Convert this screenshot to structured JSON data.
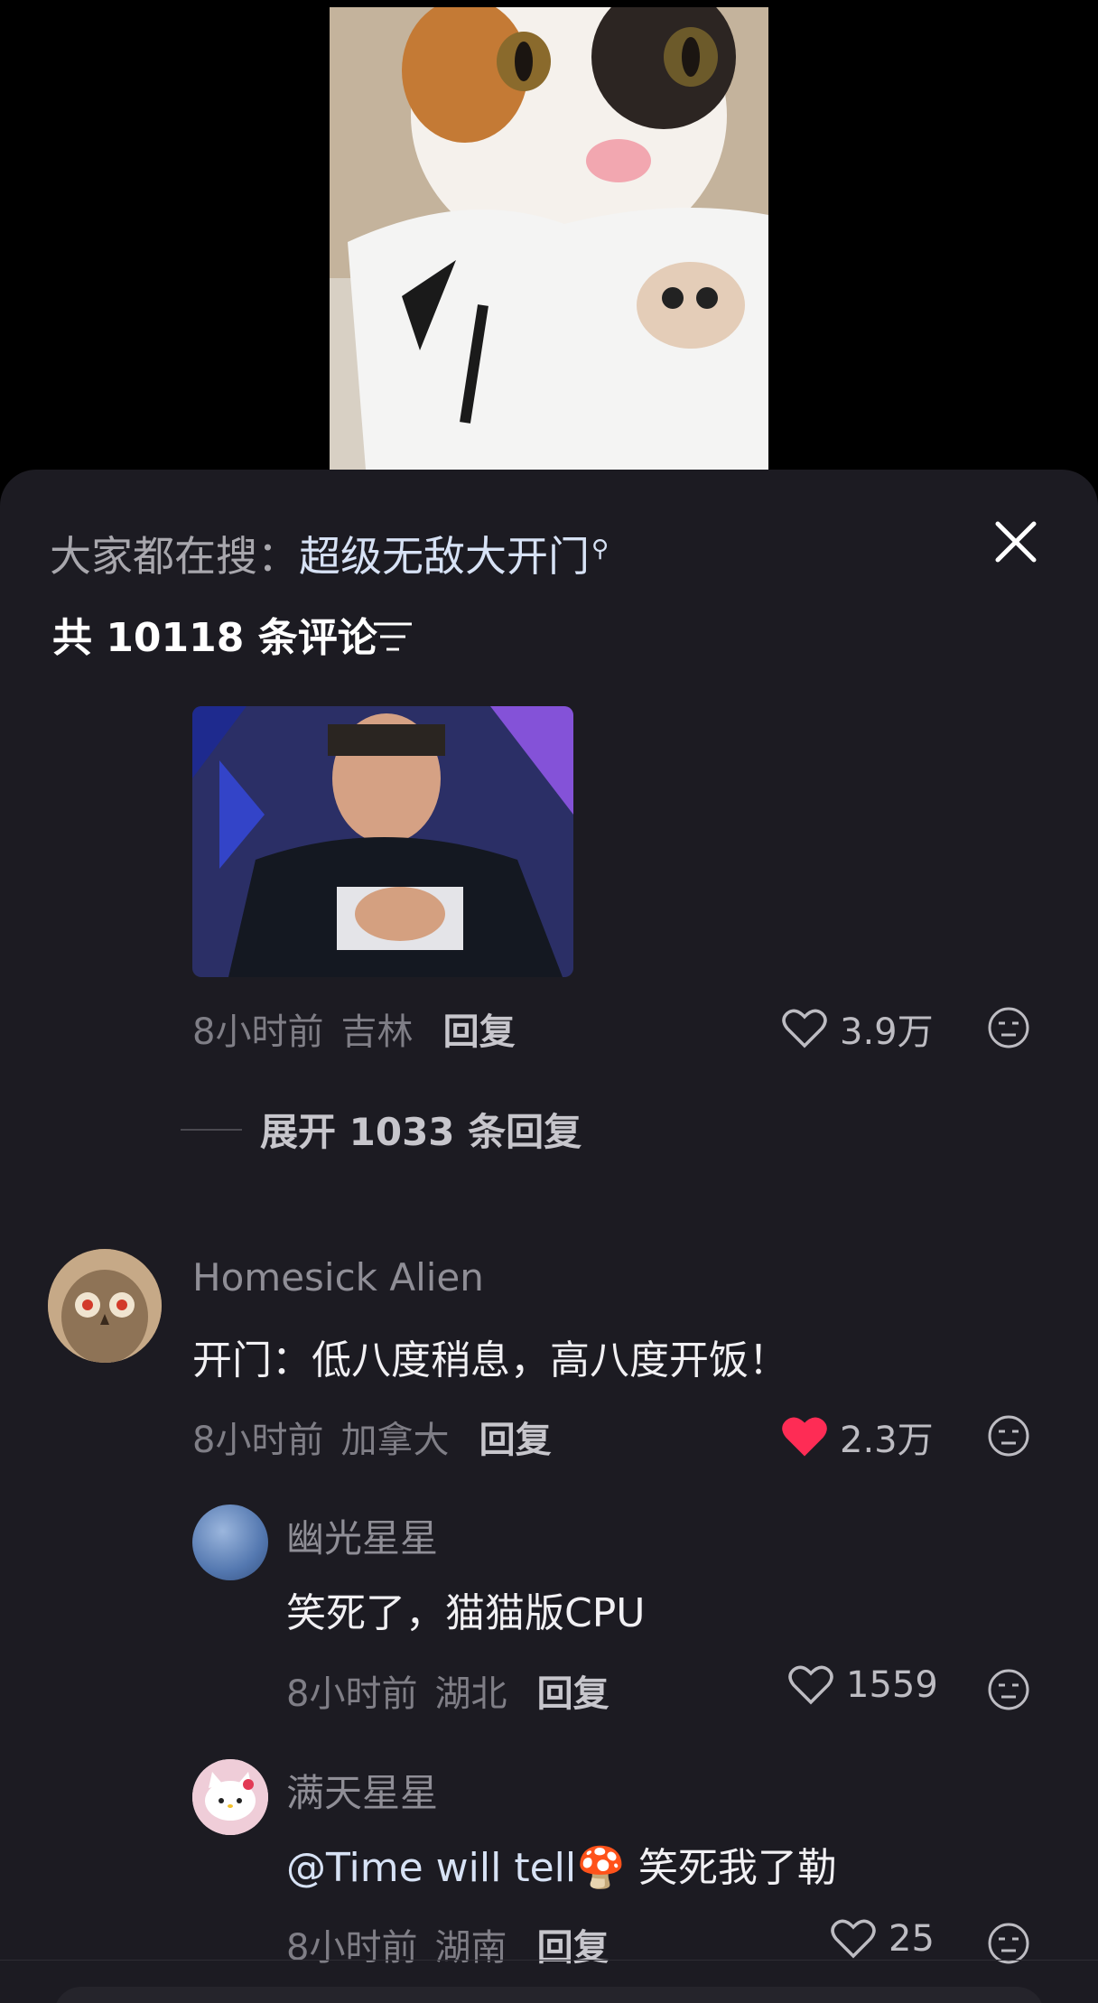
{
  "search": {
    "prefix": "大家都在搜：",
    "keyword": "超级无敌大开门"
  },
  "comments_header": {
    "count_label": "共 10118 条评论"
  },
  "first_comment": {
    "time": "8小时前",
    "location": "吉林",
    "reply_label": "回复",
    "likes": "3.9万",
    "liked": false
  },
  "expand_replies": {
    "label": "展开 1033 条回复"
  },
  "comments": [
    {
      "name": "Homesick Alien",
      "text": "开门：低八度稍息，高八度开饭！",
      "time": "8小时前",
      "location": "加拿大",
      "reply_label": "回复",
      "likes": "2.3万",
      "liked": true,
      "liked_color": "#fe2c55"
    },
    {
      "name": "幽光星星",
      "text": "笑死了，猫猫版CPU",
      "time": "8小时前",
      "location": "湖北",
      "reply_label": "回复",
      "likes": "1559",
      "liked": false
    },
    {
      "name": "满天星星",
      "text_prefix": "@Time will tell",
      "text_emoji": "🍄",
      "text_suffix": " 笑死我了勒",
      "time": "8小时前",
      "location": "湖南",
      "reply_label": "回复",
      "likes": "25",
      "liked": false
    }
  ],
  "icons": {
    "close": "close-icon",
    "filter": "filter-icon",
    "heart": "heart-icon",
    "dislike": "dislike-face-icon",
    "search": "search-icon"
  }
}
